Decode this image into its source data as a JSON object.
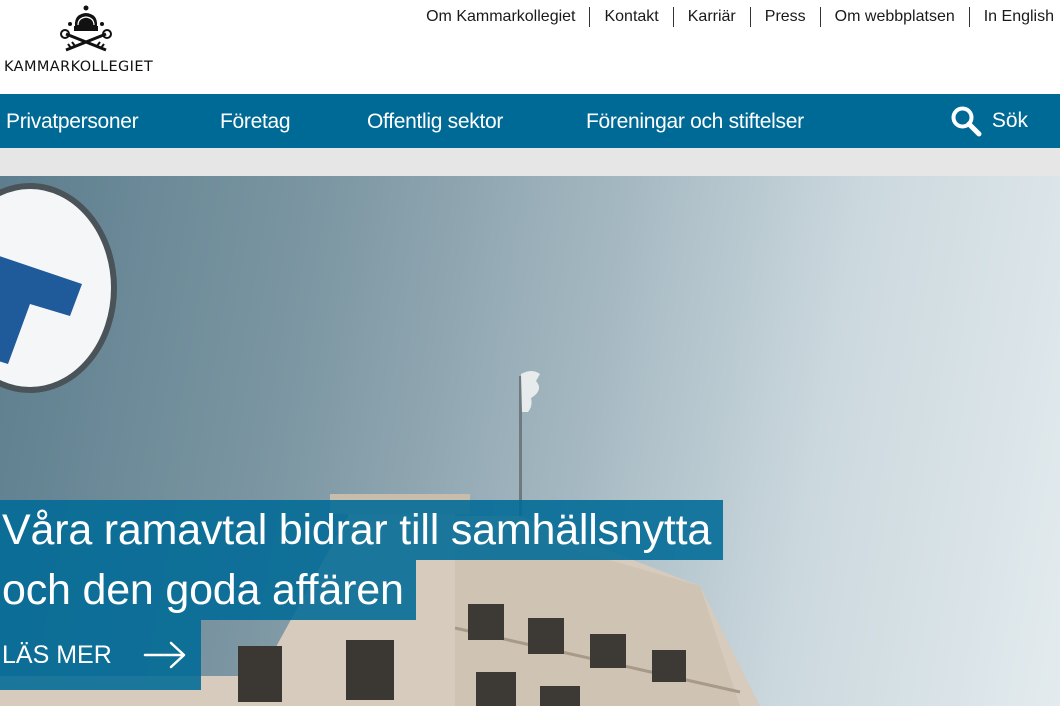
{
  "header": {
    "logo_text": "KAMMARKOLLEGIET",
    "top_links": [
      "Om Kammarkollegiet",
      "Kontakt",
      "Karriär",
      "Press",
      "Om webbplatsen",
      "In English"
    ]
  },
  "nav": {
    "items": [
      "Privatpersoner",
      "Företag",
      "Offentlig sektor",
      "Föreningar och stiftelser"
    ],
    "search_label": "Sök"
  },
  "hero": {
    "headline_line1": "Våra ramavtal bidrar till samhällsnytta",
    "headline_line2": "och den goda affären",
    "cta_label": "LÄS MER"
  },
  "colors": {
    "brand_blue": "#006a96",
    "grey_bar": "#e6e6e6"
  },
  "icons": {
    "logo": "crown-with-keys-icon",
    "search": "search-icon",
    "cta_arrow": "arrow-right-icon"
  }
}
